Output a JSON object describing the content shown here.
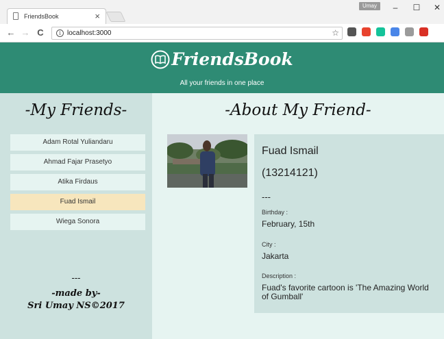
{
  "browser": {
    "tab_title": "FriendsBook",
    "tab_close": "×",
    "user_badge": "Umay",
    "url": "localhost:3000",
    "icons": [
      "page-icon",
      "back-icon",
      "forward-icon",
      "reload-icon",
      "info-icon",
      "star-icon",
      "minimize-icon",
      "maximize-icon",
      "close-icon"
    ],
    "window_controls": {
      "minimize": "–",
      "maximize": "☐",
      "close": "✕"
    },
    "nav": {
      "back": "←",
      "forward": "→",
      "reload": "C",
      "info": "i",
      "star": "☆"
    },
    "extensions": [
      {
        "name": "shield-extension-icon",
        "color": "#555555"
      },
      {
        "name": "vivaldi-extension-icon",
        "color": "#e8432e"
      },
      {
        "name": "grammarly-extension-icon",
        "color": "#15c39a"
      },
      {
        "name": "translate-extension-icon",
        "color": "#4a86e8"
      },
      {
        "name": "hand-extension-icon",
        "color": "#9b9b9b"
      },
      {
        "name": "gmail-extension-icon",
        "color": "#d93025"
      }
    ]
  },
  "header": {
    "logo_text": "FriendsBook",
    "tagline": "All your friends in one place",
    "colors": {
      "header_bg": "#2e8b74",
      "sidebar_bg": "#cde2df",
      "main_bg": "#e6f4f1",
      "selected_bg": "#f7e6bd"
    }
  },
  "sidebar": {
    "title": "-My Friends-",
    "friends": [
      {
        "name": "Adam Rotal Yuliandaru",
        "selected": false
      },
      {
        "name": "Ahmad Fajar Prasetyo",
        "selected": false
      },
      {
        "name": "Atika Firdaus",
        "selected": false
      },
      {
        "name": "Fuad Ismail",
        "selected": true
      },
      {
        "name": "Wiega Sonora",
        "selected": false
      }
    ],
    "footer_dash": "---",
    "footer_made": "-made by-",
    "footer_credit": "Sri Umay NS©2017"
  },
  "main": {
    "title": "-About My Friend-",
    "name": "Fuad Ismail",
    "id": "(13214121)",
    "dash": "---",
    "birthday_label": "Birthday :",
    "birthday": "February, 15th",
    "city_label": "City :",
    "city": "Jakarta",
    "description_label": "Description :",
    "description": "Fuad's favorite cartoon is 'The Amazing World of Gumball'"
  }
}
